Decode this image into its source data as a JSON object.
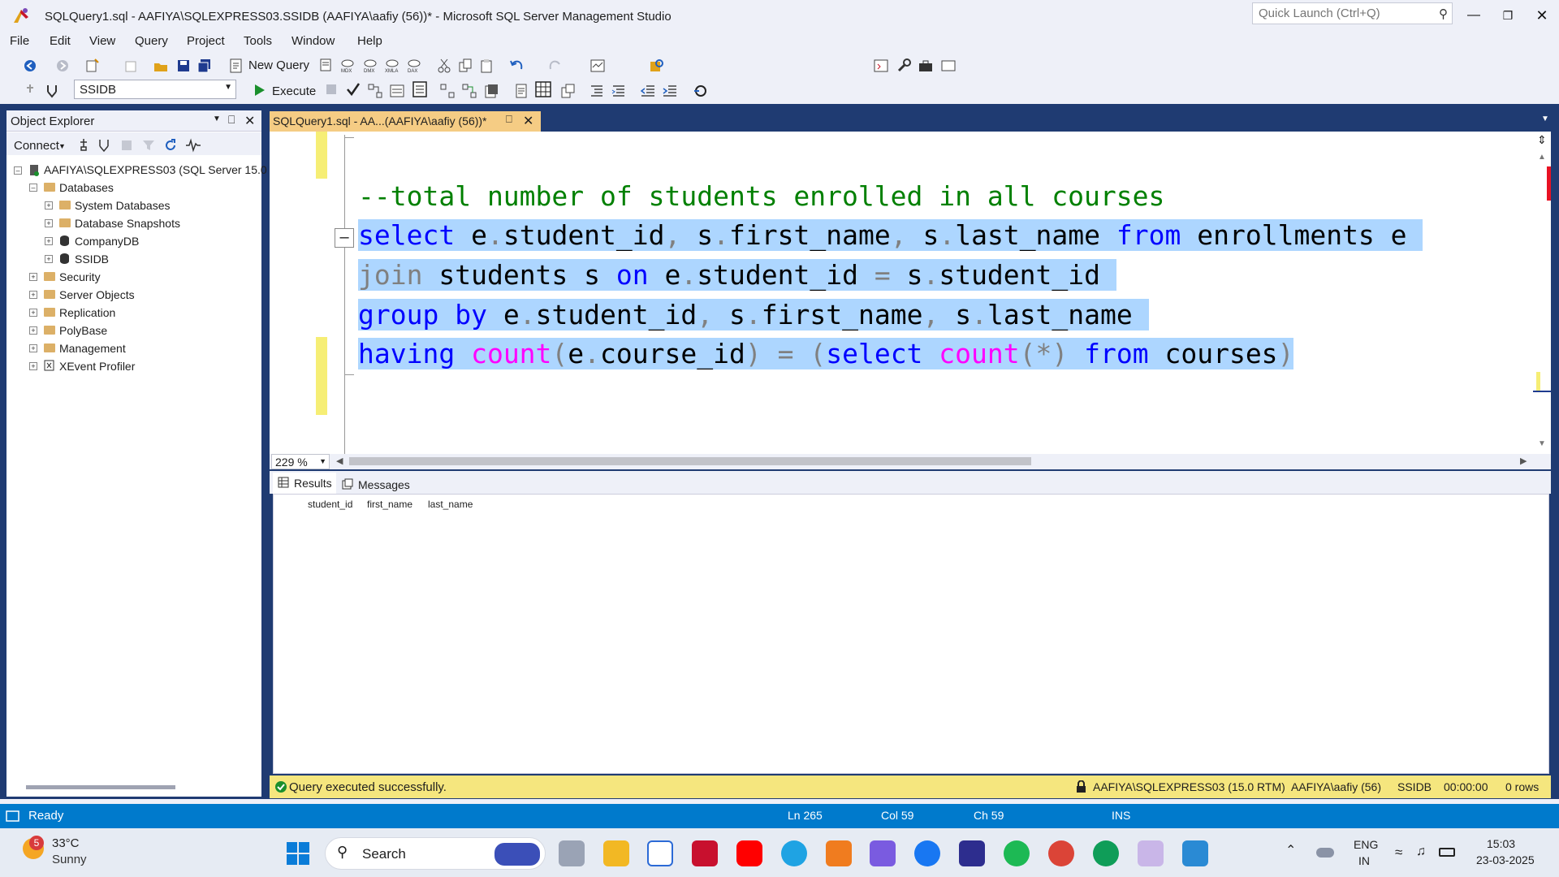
{
  "window": {
    "title": "SQLQuery1.sql - AAFIYA\\SQLEXPRESS03.SSIDB (AAFIYA\\aafiy (56))* - Microsoft SQL Server Management Studio",
    "quick_launch_placeholder": "Quick Launch (Ctrl+Q)",
    "controls": [
      "minimize-icon",
      "restore-icon",
      "close-icon"
    ]
  },
  "menu": [
    "File",
    "Edit",
    "View",
    "Query",
    "Project",
    "Tools",
    "Window",
    "Help"
  ],
  "toolbar": {
    "new_query_label": "New Query",
    "execute_label": "Execute",
    "database": "SSIDB"
  },
  "object_explorer": {
    "title": "Object Explorer",
    "connect_label": "Connect",
    "server": "AAFIYA\\SQLEXPRESS03 (SQL Server 15.0",
    "nodes": {
      "databases": "Databases",
      "system_databases": "System Databases",
      "database_snapshots": "Database Snapshots",
      "companydb": "CompanyDB",
      "ssidb": "SSIDB",
      "security": "Security",
      "server_objects": "Server Objects",
      "replication": "Replication",
      "polybase": "PolyBase",
      "management": "Management",
      "xevent_profiler": "XEvent Profiler"
    }
  },
  "editor": {
    "tab_label": "SQLQuery1.sql - AA...(AAFIYA\\aafiy (56))*",
    "zoom": "229 %",
    "code": {
      "comment": "--total number of students enrolled in all courses",
      "l1": {
        "a": "select",
        "b": " e",
        "c": ".",
        "d": "student_id",
        "e": ",",
        "f": " s",
        "g": ".",
        "h": "first_name",
        "i": ",",
        "j": " s",
        "k": ".",
        "l": "last_name ",
        "m": "from",
        "n": " enrollments e"
      },
      "l2": {
        "a": "join",
        "b": " students s ",
        "c": "on",
        "d": " e",
        "e": ".",
        "f": "student_id ",
        "g": "=",
        "h": " s",
        "i": ".",
        "j": "student_id"
      },
      "l3": {
        "a": "group by",
        "b": " e",
        "c": ".",
        "d": "student_id",
        "e": ",",
        "f": " s",
        "g": ".",
        "h": "first_name",
        "i": ",",
        "j": " s",
        "k": ".",
        "l": "last_name"
      },
      "l4": {
        "a": "having ",
        "b": "count",
        "c": "(",
        "d": "e",
        "e": ".",
        "f": "course_id",
        "g": ")",
        "h": " = ",
        "i": "(",
        "j": "select",
        "k": " count",
        "l": "(*)",
        "m": " from",
        "n": " courses",
        "o": ")"
      }
    }
  },
  "results": {
    "tab_results": "Results",
    "tab_messages": "Messages",
    "columns": [
      "student_id",
      "first_name",
      "last_name"
    ],
    "rows": []
  },
  "query_status": {
    "message": "Query executed successfully.",
    "server": "AAFIYA\\SQLEXPRESS03 (15.0 RTM)",
    "user": "AAFIYA\\aafiy (56)",
    "database": "SSIDB",
    "elapsed": "00:00:00",
    "rows": "0 rows"
  },
  "statusbar": {
    "ready": "Ready",
    "ln": "Ln 265",
    "col": "Col 59",
    "ch": "Ch 59",
    "mode": "INS"
  },
  "taskbar": {
    "weather_badge": "5",
    "temperature": "33°C",
    "condition": "Sunny",
    "search_label": "Search",
    "lang": "ENG",
    "region": "IN",
    "time": "15:03",
    "date": "23-03-2025"
  },
  "colors": {
    "accent_blue": "#007acc",
    "dock_blue": "#1f3b72",
    "tab_gold": "#f5cc84",
    "selection": "#add6ff",
    "keyword": "#0000ff",
    "comment": "#008000",
    "function": "#ff00ff"
  }
}
